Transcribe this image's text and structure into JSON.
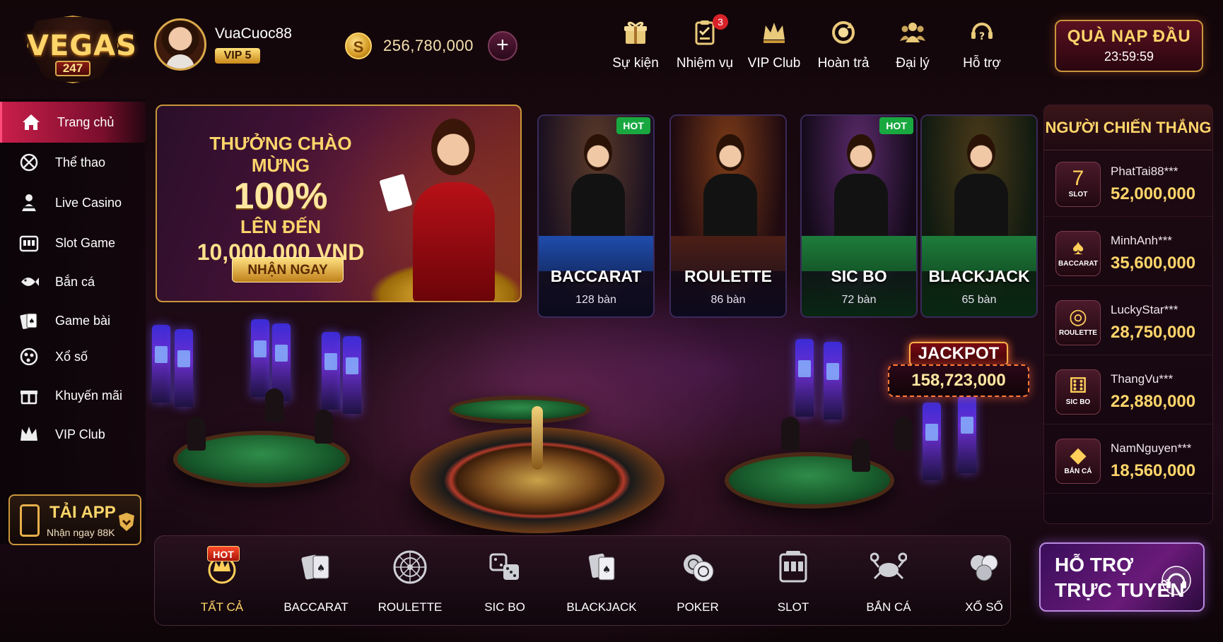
{
  "brand": {
    "logo_main": "VEGAS",
    "logo_sub": "247"
  },
  "user": {
    "name": "VuaCuoc88",
    "vip": "VIP 5",
    "balance": "256,780,000",
    "coin_symbol": "S"
  },
  "topnav": [
    {
      "label": "Sự kiện",
      "icon": "gift-icon"
    },
    {
      "label": "Nhiệm vụ",
      "icon": "clipboard-icon",
      "badge": "3"
    },
    {
      "label": "VIP Club",
      "icon": "crown-icon"
    },
    {
      "label": "Hoàn trả",
      "icon": "refresh-coin-icon"
    },
    {
      "label": "Đại lý",
      "icon": "agents-icon"
    },
    {
      "label": "Hỗ trợ",
      "icon": "help-icon"
    }
  ],
  "first_deposit": {
    "title": "QUÀ NẠP ĐẦU",
    "timer": "23:59:59"
  },
  "sidebar": [
    {
      "label": "Trang chủ",
      "icon": "home-icon"
    },
    {
      "label": "Thể thao",
      "icon": "sports-icon"
    },
    {
      "label": "Live Casino",
      "icon": "dealer-icon"
    },
    {
      "label": "Slot Game",
      "icon": "slot-icon"
    },
    {
      "label": "Bắn cá",
      "icon": "fish-icon"
    },
    {
      "label": "Game bài",
      "icon": "cards-icon"
    },
    {
      "label": "Xổ số",
      "icon": "lottery-icon"
    },
    {
      "label": "Khuyến mãi",
      "icon": "gift-icon"
    },
    {
      "label": "VIP Club",
      "icon": "crown-icon"
    }
  ],
  "app": {
    "title": "TẢI APP",
    "subtitle": "Nhận ngay 88K"
  },
  "promo": {
    "line1": "THƯỞNG CHÀO MỪNG",
    "line2": "100%",
    "line3": "LÊN ĐẾN",
    "line4": "10,000,000 VND",
    "button": "NHẬN NGAY"
  },
  "games": [
    {
      "name": "BACCARAT",
      "tables": "128 bàn",
      "tag": "HOT",
      "felt": "#1e4aa8"
    },
    {
      "name": "ROULETTE",
      "tables": "86 bàn",
      "tag": "",
      "felt": "#4a1e16"
    },
    {
      "name": "SIC BO",
      "tables": "72 bàn",
      "tag": "HOT",
      "felt": "#1d7a3a"
    },
    {
      "name": "BLACKJACK",
      "tables": "65 bàn",
      "tag": "",
      "felt": "#1d7a3a"
    }
  ],
  "jackpot": {
    "title": "JACKPOT",
    "value": "158,723,000"
  },
  "winners": {
    "title": "NGƯỜI CHIẾN THẮNG",
    "items": [
      {
        "name": "PhatTai88***",
        "amount": "52,000,000",
        "game": "SLOT",
        "symbol": "7"
      },
      {
        "name": "MinhAnh***",
        "amount": "35,600,000",
        "game": "BACCARAT",
        "symbol": "♠"
      },
      {
        "name": "LuckyStar***",
        "amount": "28,750,000",
        "game": "ROULETTE",
        "symbol": "◎"
      },
      {
        "name": "ThangVu***",
        "amount": "22,880,000",
        "game": "SIC BO",
        "symbol": "⚅"
      },
      {
        "name": "NamNguyen***",
        "amount": "18,560,000",
        "game": "BẮN CÁ",
        "symbol": "◆"
      }
    ]
  },
  "categories": {
    "hot_tag": "HOT",
    "items": [
      {
        "label": "TẤT CẢ",
        "icon": "crown-chip-icon"
      },
      {
        "label": "BACCARAT",
        "icon": "cards-icon"
      },
      {
        "label": "ROULETTE",
        "icon": "roulette-icon"
      },
      {
        "label": "SIC BO",
        "icon": "dice-icon"
      },
      {
        "label": "BLACKJACK",
        "icon": "blackjack-icon"
      },
      {
        "label": "POKER",
        "icon": "poker-chips-icon"
      },
      {
        "label": "SLOT",
        "icon": "slot-machine-icon"
      },
      {
        "label": "BẮN CÁ",
        "icon": "crab-icon"
      },
      {
        "label": "XỔ SỐ",
        "icon": "lottery-balls-icon"
      }
    ]
  },
  "support": {
    "line1": "HỖ TRỢ",
    "line2": "TRỰC TUYẾN",
    "icon": "headset-icon"
  },
  "colors": {
    "accent": "#ffd56a",
    "active": "#c81e4a",
    "hot": "#19a840"
  }
}
